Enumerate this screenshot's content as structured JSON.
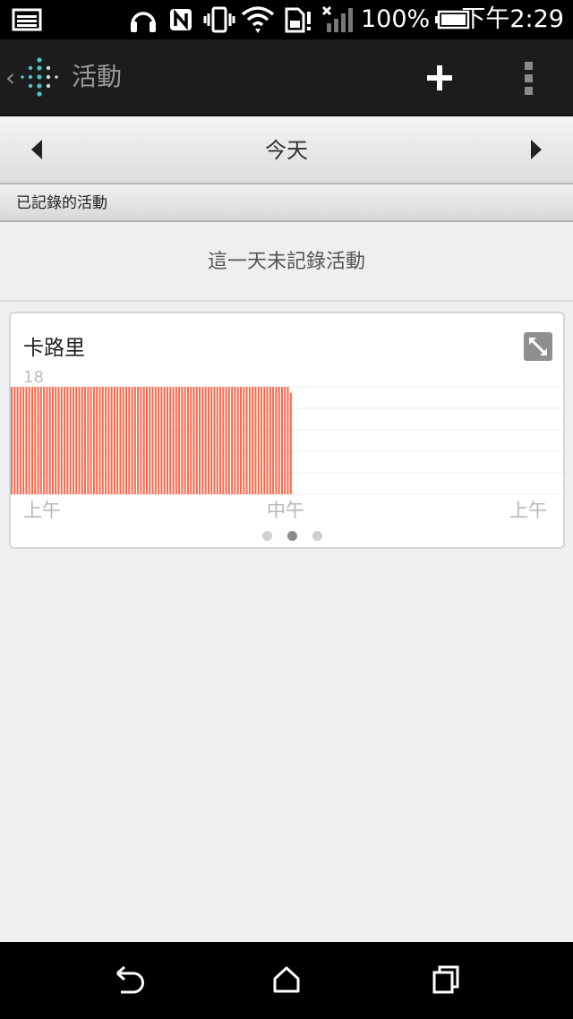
{
  "status_bar": {
    "time": "下午2:29",
    "battery_percent": "100%",
    "icons": [
      "gallery-icon",
      "headset-icon",
      "nfc-icon",
      "vibrate-icon",
      "wifi-icon",
      "sim-icon",
      "signal-icon",
      "battery-icon"
    ]
  },
  "action_bar": {
    "title": "活動",
    "back_glyph": "‹",
    "add_icon": "plus-icon",
    "overflow_icon": "overflow-menu-icon",
    "logo": "fitbit-logo"
  },
  "date_nav": {
    "label": "今天",
    "prev_icon": "arrow-left-icon",
    "next_icon": "arrow-right-icon"
  },
  "logged_activities": {
    "header": "已記錄的活動",
    "empty_message": "這一天未記錄活動"
  },
  "calorie_card": {
    "title": "卡路里",
    "expand_icon": "expand-icon",
    "active_page": 1,
    "page_count": 3
  },
  "chart_data": {
    "type": "bar",
    "title": "卡路里",
    "y_max_label": "18",
    "ylim": [
      0,
      18
    ],
    "x_tick_labels": [
      "上午",
      "中午",
      "上午"
    ],
    "bar_color": "#f26b4f",
    "grid": true,
    "values": [
      18,
      18,
      18,
      18,
      18,
      18,
      18,
      18,
      18,
      18,
      18,
      18,
      18,
      18,
      18,
      18,
      18,
      18,
      18,
      18,
      18,
      18,
      18,
      18,
      18,
      18,
      18,
      18,
      18,
      18,
      18,
      18,
      18,
      18,
      18,
      18,
      18,
      18,
      18,
      18,
      18,
      18,
      18,
      18,
      18,
      18,
      18,
      18,
      18,
      18,
      18,
      18,
      18,
      18,
      18,
      18,
      18,
      18,
      18,
      18,
      18,
      18,
      18,
      18,
      18,
      18,
      18,
      18,
      18,
      18,
      18,
      18,
      18,
      18,
      18,
      18,
      18,
      18,
      18,
      18,
      18,
      18,
      18,
      18,
      18,
      18,
      18,
      18,
      18,
      18,
      18,
      18,
      18,
      18,
      18,
      17,
      null,
      null,
      null,
      null,
      null,
      null,
      null,
      null,
      null,
      null,
      null,
      null,
      null,
      null,
      null,
      null,
      null,
      null,
      null,
      null,
      null,
      null,
      null,
      null,
      null,
      null,
      null,
      null,
      null,
      null,
      null,
      null,
      null,
      null,
      null,
      null,
      null,
      null,
      null,
      null,
      null,
      null,
      null,
      null,
      null,
      null,
      null,
      null,
      null,
      null,
      null,
      null,
      null,
      null,
      null,
      null,
      null,
      null,
      null,
      null,
      null,
      null,
      null,
      null,
      null,
      null,
      null,
      null,
      null,
      null,
      null,
      null,
      null,
      null,
      null,
      null,
      null,
      null,
      null,
      null,
      null,
      null,
      null,
      null,
      null,
      null,
      null,
      null,
      null,
      null,
      null,
      null
    ]
  },
  "nav_bar": {
    "back_icon": "back-icon",
    "home_icon": "home-icon",
    "recents_icon": "recent-apps-icon"
  },
  "colors": {
    "accent": "#f26b4f",
    "logo_teal": "#4fc3c7",
    "action_bar": "#1c1c1c"
  }
}
